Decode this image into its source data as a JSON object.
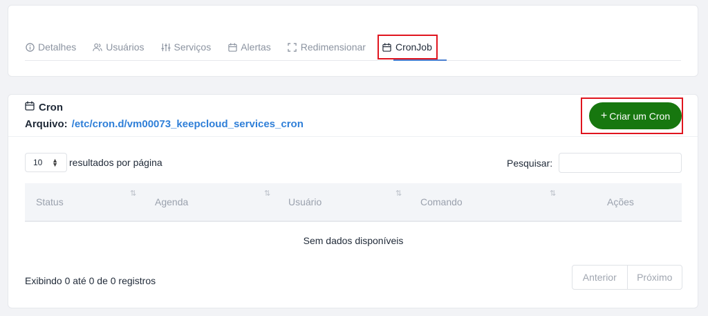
{
  "tabs": [
    {
      "label": "Detalhes",
      "icon": "info-circle-icon"
    },
    {
      "label": "Usuários",
      "icon": "users-icon"
    },
    {
      "label": "Serviços",
      "icon": "sliders-icon"
    },
    {
      "label": "Alertas",
      "icon": "calendar-icon"
    },
    {
      "label": "Redimensionar",
      "icon": "resize-icon"
    },
    {
      "label": "CronJob",
      "icon": "calendar-icon",
      "active": true
    }
  ],
  "cron": {
    "title": "Cron",
    "file_label": "Arquivo:",
    "file_path": "/etc/cron.d/vm00073_keepcloud_services_cron",
    "create_label": "Criar um Cron",
    "create_color": "#17770f"
  },
  "controls": {
    "page_size": "10",
    "per_page_label": "resultados por página",
    "search_label": "Pesquisar:",
    "search_value": ""
  },
  "table": {
    "columns": [
      "Status",
      "Agenda",
      "Usuário",
      "Comando",
      "Ações"
    ],
    "empty_message": "Sem dados disponíveis"
  },
  "footer": {
    "info": "Exibindo 0 até 0 de 0 registros",
    "prev_label": "Anterior",
    "next_label": "Próximo"
  }
}
